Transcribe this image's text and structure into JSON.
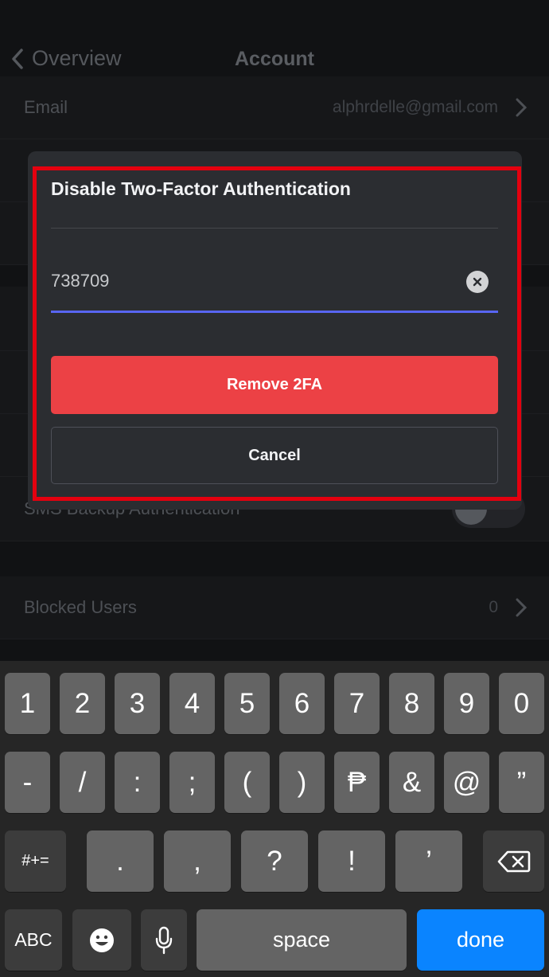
{
  "nav": {
    "back_label": "Overview",
    "title": "Account"
  },
  "rows": {
    "email_label": "Email",
    "email_value": "alphrdelle@gmail.com",
    "sms_label": "SMS Backup Authentication",
    "blocked_label": "Blocked Users",
    "blocked_value": "0"
  },
  "modal": {
    "title": "Disable Two-Factor Authentication",
    "code_value": "738709",
    "remove_label": "Remove 2FA",
    "cancel_label": "Cancel"
  },
  "keyboard": {
    "row1": [
      "1",
      "2",
      "3",
      "4",
      "5",
      "6",
      "7",
      "8",
      "9",
      "0"
    ],
    "row2": [
      "-",
      "/",
      ":",
      ";",
      "(",
      ")",
      "₱",
      "&",
      "@",
      "”"
    ],
    "row3_mode": "#+=",
    "row3": [
      ".",
      ",",
      "?",
      "!",
      "’"
    ],
    "abc_label": "ABC",
    "space_label": "space",
    "done_label": "done"
  },
  "colors": {
    "accent": "#5865f2",
    "danger": "#ec4145",
    "highlight": "#e4000f",
    "done_key": "#0a84ff"
  },
  "icons": {
    "back": "chevron-left-icon",
    "clear": "clear-circle-icon",
    "delete": "backspace-icon",
    "emoji": "emoji-icon",
    "mic": "microphone-icon"
  }
}
